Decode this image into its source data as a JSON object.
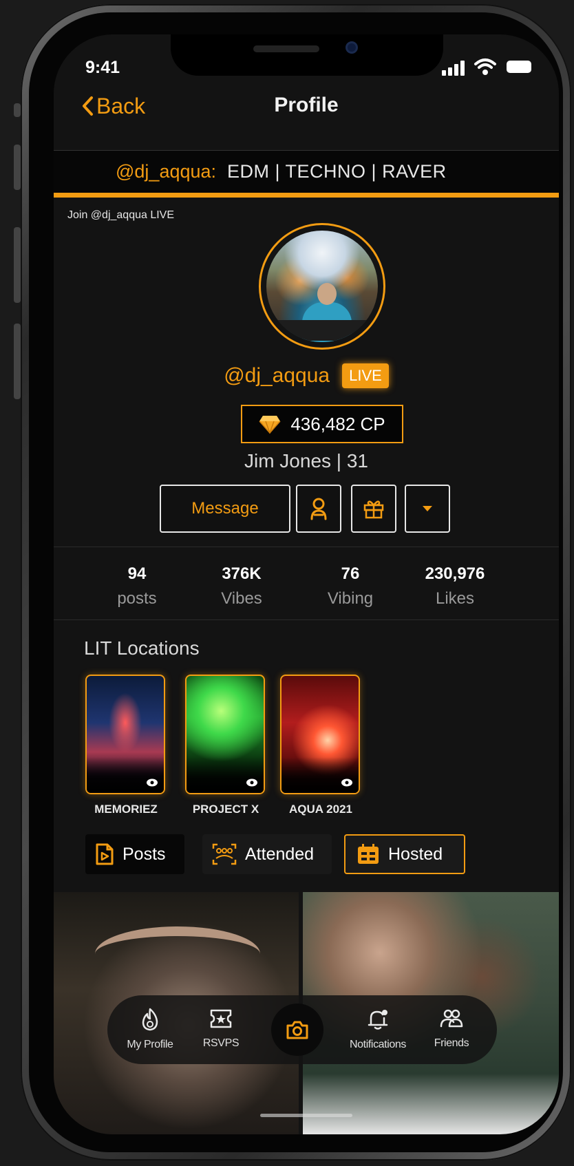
{
  "status_bar": {
    "time": "9:41"
  },
  "header": {
    "back_label": "Back",
    "title": "Profile"
  },
  "tags_banner": {
    "handle": "@dj_aqqua:",
    "tags": "EDM | TECHNO | RAVER"
  },
  "join_live": "Join @dj_aqqua LIVE",
  "profile": {
    "username": "@dj_aqqua",
    "live_badge": "LIVE",
    "cp": "436,482 CP",
    "name_age": "Jim Jones | 31"
  },
  "actions": {
    "message_label": "Message"
  },
  "stats": [
    {
      "value": "94",
      "label": "posts"
    },
    {
      "value": "376K",
      "label": "Vibes"
    },
    {
      "value": "76",
      "label": "Vibing"
    },
    {
      "value": "230,976",
      "label": "Likes"
    }
  ],
  "lit_locations": {
    "title": "LIT Locations",
    "items": [
      {
        "label": "MEMORIEZ"
      },
      {
        "label": "PROJECT X"
      },
      {
        "label": "AQUA 2021"
      }
    ]
  },
  "tabs": [
    {
      "label": "Posts",
      "icon": "video-file-icon"
    },
    {
      "label": "Attended",
      "icon": "group-scan-icon"
    },
    {
      "label": "Hosted",
      "icon": "calendar-icon",
      "selected": true
    }
  ],
  "bottom_nav": [
    {
      "label": "My Profile",
      "icon": "profile-flame-icon"
    },
    {
      "label": "RSVPS",
      "icon": "ticket-icon"
    },
    {
      "label": "",
      "icon": "camera-icon"
    },
    {
      "label": "Notifications",
      "icon": "bell-icon"
    },
    {
      "label": "Friends",
      "icon": "friends-icon"
    }
  ],
  "colors": {
    "accent": "#f39c12",
    "background": "#131313"
  }
}
